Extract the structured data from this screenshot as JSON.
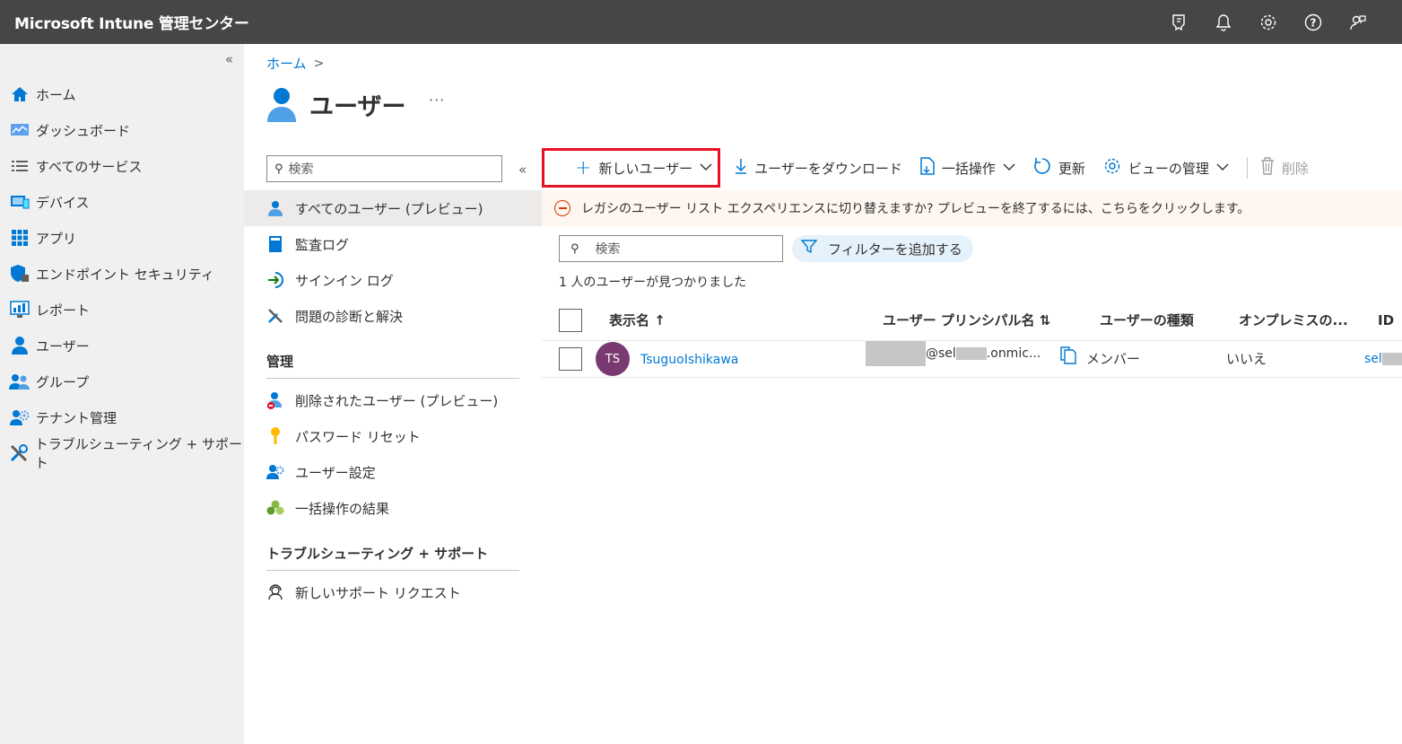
{
  "app": {
    "title": "Microsoft Intune 管理センター"
  },
  "topbar_icons": [
    "portal-feedback-icon",
    "bell-icon",
    "gear-icon",
    "help-icon",
    "feedback-person-icon"
  ],
  "leftnav": {
    "collapse": "«",
    "items": [
      {
        "label": "ホーム",
        "icon": "home-icon"
      },
      {
        "label": "ダッシュボード",
        "icon": "dashboard-icon"
      },
      {
        "label": "すべてのサービス",
        "icon": "list-icon"
      },
      {
        "label": "デバイス",
        "icon": "device-icon"
      },
      {
        "label": "アプリ",
        "icon": "apps-grid-icon"
      },
      {
        "label": "エンドポイント セキュリティ",
        "icon": "shield-icon"
      },
      {
        "label": "レポート",
        "icon": "report-icon"
      },
      {
        "label": "ユーザー",
        "icon": "user-icon"
      },
      {
        "label": "グループ",
        "icon": "group-icon"
      },
      {
        "label": "テナント管理",
        "icon": "tenant-icon"
      },
      {
        "label": "トラブルシューティング + サポート",
        "icon": "wrench-icon"
      }
    ]
  },
  "breadcrumb": {
    "home": "ホーム",
    "sep": ">"
  },
  "page": {
    "title": "ユーザー",
    "more": "···"
  },
  "subnav": {
    "search_placeholder": "検索",
    "collapse": "«",
    "items": [
      {
        "label": "すべてのユーザー (プレビュー)",
        "active": true
      },
      {
        "label": "監査ログ"
      },
      {
        "label": "サインイン ログ"
      },
      {
        "label": "問題の診断と解決"
      }
    ],
    "section_manage": "管理",
    "manage_items": [
      {
        "label": "削除されたユーザー (プレビュー)"
      },
      {
        "label": "パスワード リセット"
      },
      {
        "label": "ユーザー設定"
      },
      {
        "label": "一括操作の結果"
      }
    ],
    "section_support": "トラブルシューティング + サポート",
    "support_items": [
      {
        "label": "新しいサポート リクエスト"
      }
    ]
  },
  "toolbar": {
    "new_user": "新しいユーザー",
    "download": "ユーザーをダウンロード",
    "bulk": "一括操作",
    "refresh": "更新",
    "manage_view": "ビューの管理",
    "delete": "削除"
  },
  "banner": {
    "text": "レガシのユーザー リスト エクスペリエンスに切り替えますか? プレビューを終了するには、こちらをクリックします。"
  },
  "search": {
    "placeholder": "検索"
  },
  "filter": {
    "label": "フィルターを追加する"
  },
  "result_count": "1 人のユーザーが見つかりました",
  "table": {
    "headers": {
      "display_name": "表示名 ↑",
      "upn": "ユーザー プリンシパル名 ⇅",
      "user_type": "ユーザーの種類",
      "onprem": "オンプレミスの...",
      "id": "ID"
    },
    "rows": [
      {
        "initials": "TS",
        "display_name": "TsuguoIshikawa",
        "upn_part1": "@sel",
        "upn_part2": ".onmic...",
        "user_type": "メンバー",
        "onprem": "いいえ",
        "id": "sel"
      }
    ]
  }
}
